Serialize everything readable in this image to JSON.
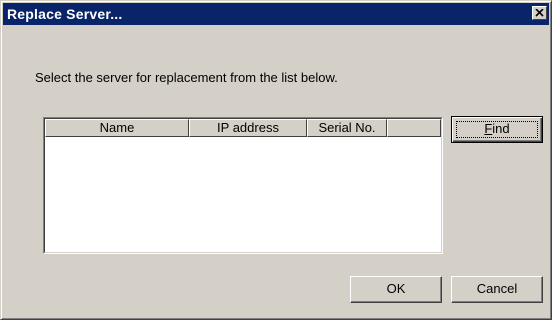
{
  "window": {
    "title": "Replace Server...",
    "close_glyph": "close-icon"
  },
  "prompt": "Select the server for replacement from the list below.",
  "server_list": {
    "columns": [
      "Name",
      "IP address",
      "Serial No.",
      ""
    ],
    "rows": []
  },
  "buttons": {
    "find_accel": "F",
    "find_rest": "ind",
    "ok": "OK",
    "cancel": "Cancel"
  }
}
